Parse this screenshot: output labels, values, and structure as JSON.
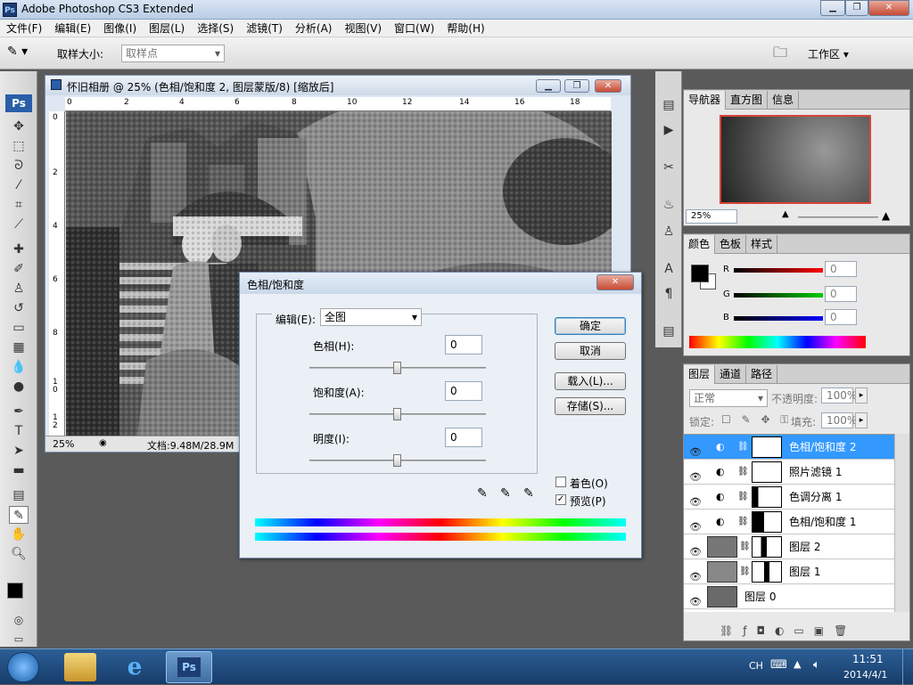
{
  "window": {
    "title": "Adobe Photoshop CS3 Extended",
    "app_icon": "Ps"
  },
  "menubar": {
    "items": [
      "文件(F)",
      "编辑(E)",
      "图像(I)",
      "图层(L)",
      "选择(S)",
      "滤镜(T)",
      "分析(A)",
      "视图(V)",
      "窗口(W)",
      "帮助(H)"
    ]
  },
  "options": {
    "sample_size_label": "取样大小:",
    "sample_size_value": "取样点",
    "workspace_label": "工作区 ▾"
  },
  "toolbox": {
    "logo": "Ps"
  },
  "document": {
    "title": "怀旧相册 @ 25% (色相/饱和度 2, 图层蒙版/8) [缩放后]",
    "ruler_top": [
      "0",
      "2",
      "4",
      "6",
      "8",
      "10",
      "12",
      "14",
      "16",
      "18"
    ],
    "ruler_left": [
      "0",
      "2",
      "4",
      "6",
      "8",
      "1\n0",
      "1\n2"
    ],
    "zoom": "25%",
    "doc_info": "文档:9.48M/28.9M"
  },
  "dialog": {
    "title": "色相/饱和度",
    "edit_label": "编辑(E):",
    "edit_value": "全图",
    "hue_label": "色相(H):",
    "hue_value": "0",
    "saturation_label": "饱和度(A):",
    "saturation_value": "0",
    "lightness_label": "明度(I):",
    "lightness_value": "0",
    "ok": "确定",
    "cancel": "取消",
    "load": "载入(L)...",
    "save": "存储(S)...",
    "colorize": "着色(O)",
    "preview": "预览(P)",
    "colorize_checked": false,
    "preview_checked": true
  },
  "navigator": {
    "tabs": [
      "导航器",
      "直方图",
      "信息"
    ],
    "zoom": "25%"
  },
  "color": {
    "tabs": [
      "颜色",
      "色板",
      "样式"
    ],
    "r_label": "R",
    "g_label": "G",
    "b_label": "B",
    "r": "0",
    "g": "0",
    "b": "0",
    "fg": "#000000",
    "bg": "#ffffff"
  },
  "layers": {
    "tabs": [
      "图层",
      "通道",
      "路径"
    ],
    "blend_mode": "正常",
    "opacity_label": "不透明度:",
    "opacity": "100%",
    "lock_label": "锁定:",
    "fill_label": "填充:",
    "fill": "100%",
    "items": [
      {
        "name": "色相/饱和度 2",
        "selected": true
      },
      {
        "name": "照片滤镜 1",
        "selected": false
      },
      {
        "name": "色调分离 1",
        "selected": false
      },
      {
        "name": "色相/饱和度 1",
        "selected": false
      },
      {
        "name": "图层 2",
        "selected": false
      },
      {
        "name": "图层 1",
        "selected": false
      },
      {
        "name": "图层 0",
        "selected": false
      }
    ]
  },
  "taskbar": {
    "app_label": "Ps",
    "lang": "CH",
    "time": "11:51",
    "date": "2014/4/1"
  },
  "colors": {
    "accent": "#3399ff",
    "titlebar": "#c5d6ea",
    "taskbar": "#1d4a7c"
  }
}
